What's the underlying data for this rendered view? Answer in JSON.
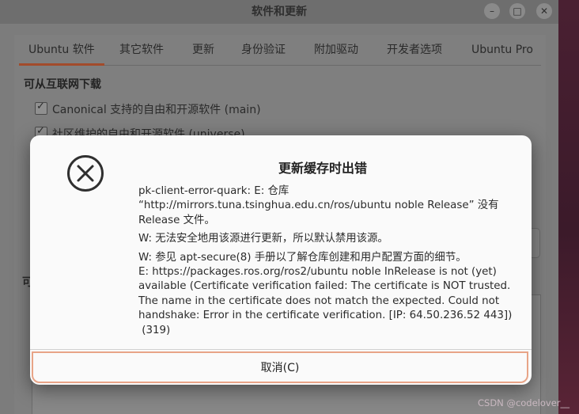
{
  "window": {
    "title": "软件和更新",
    "controls": {
      "minimize": "–",
      "maximize": "□",
      "close": "✕"
    }
  },
  "tabs": [
    {
      "label": "Ubuntu 软件",
      "active": true
    },
    {
      "label": "其它软件"
    },
    {
      "label": "更新"
    },
    {
      "label": "身份验证"
    },
    {
      "label": "附加驱动"
    },
    {
      "label": "开发者选项"
    },
    {
      "label": "Ubuntu Pro"
    }
  ],
  "downloads": {
    "section_title": "可从互联网下载",
    "items": [
      {
        "label": "Canonical 支持的自由和开源软件 (main)",
        "checked": true
      },
      {
        "label": "社区维护的自由和开源软件 (universe)",
        "checked": true
      }
    ],
    "fragment": "可"
  },
  "dialog": {
    "title": "更新缓存时出错",
    "icon": "error-circle-x-icon",
    "messages": [
      "pk-client-error-quark: E: 仓库 “http://mirrors.tuna.tsinghua.edu.cn/ros/ubuntu noble Release” 没有 Release 文件。",
      "W: 无法安全地用该源进行更新，所以默认禁用该源。",
      "W: 参见 apt-secure(8) 手册以了解仓库创建和用户配置方面的细节。",
      "E: https://packages.ros.org/ros2/ubuntu noble InRelease is not (yet) available (Certificate verification failed: The certificate is NOT trusted. The name in the certificate does not match the expected.  Could not handshake: Error in the certificate verification. [IP: 64.50.236.52 443])",
      " (319)"
    ],
    "cancel_label": "取消(C)"
  },
  "watermark": "CSDN @codelover__",
  "colors": {
    "accent": "#e8a487",
    "tab_underline": "#a24b2b"
  }
}
